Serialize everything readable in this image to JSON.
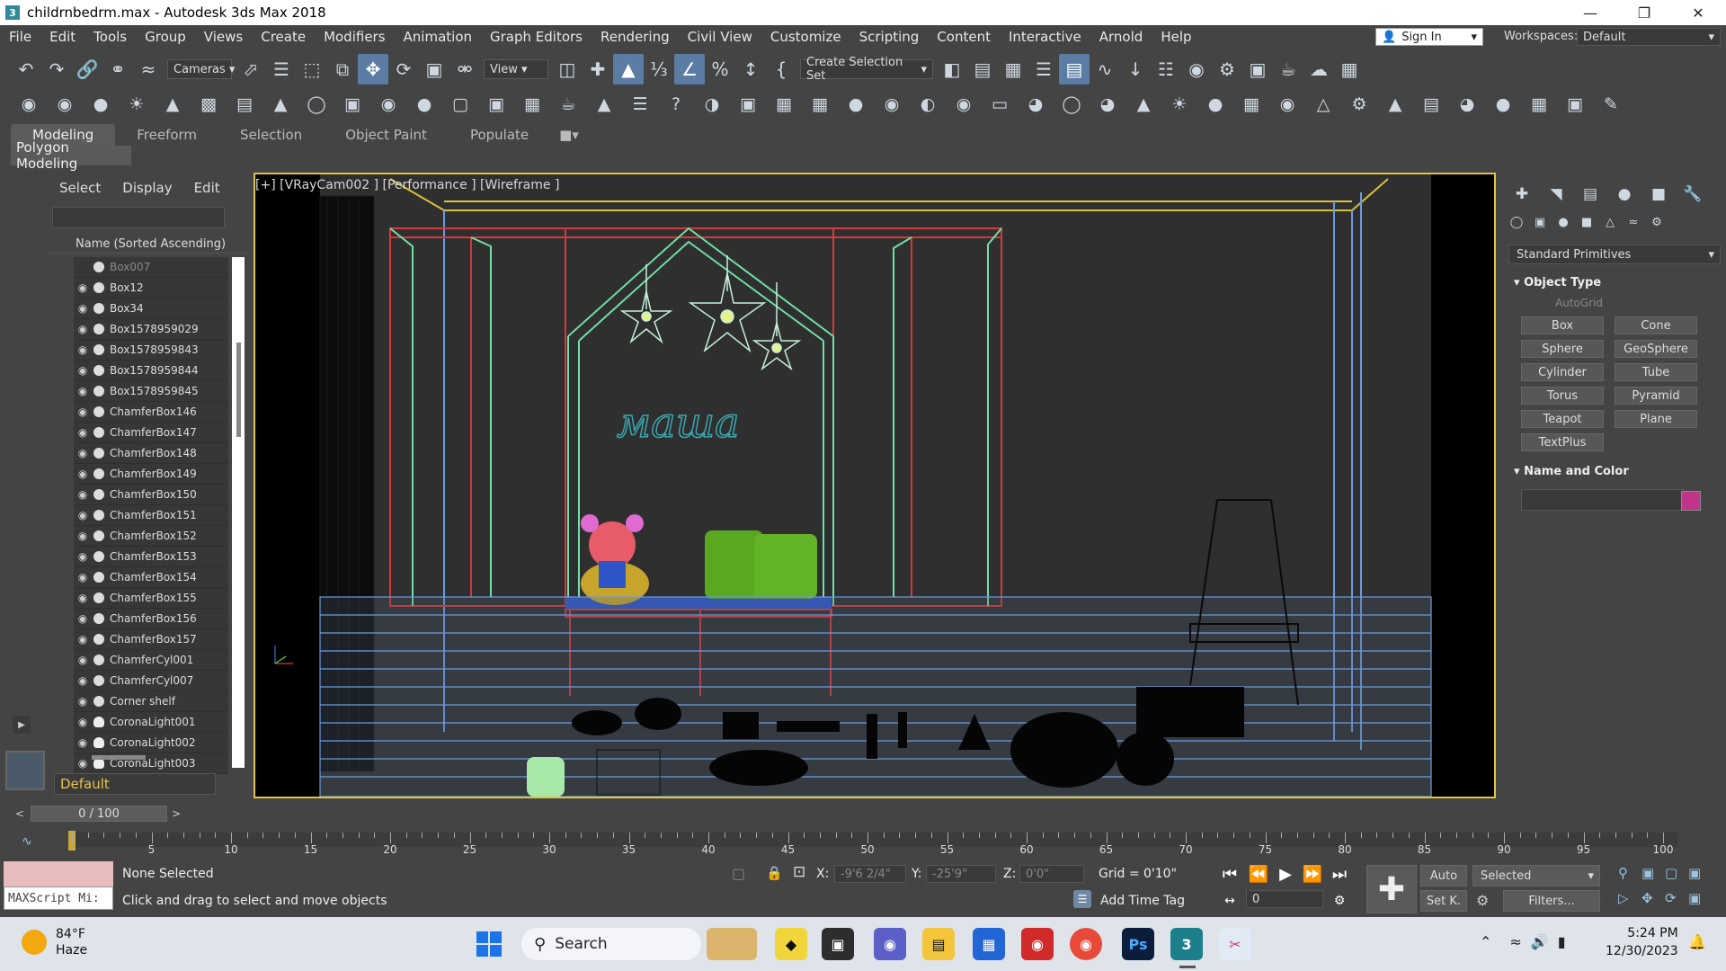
{
  "window": {
    "title": "childrnbedrm.max - Autodesk 3ds Max 2018",
    "app_icon_glyph": "3",
    "controls": [
      "minimize-icon",
      "maximize-icon",
      "close-icon"
    ]
  },
  "menu": {
    "items": [
      "File",
      "Edit",
      "Tools",
      "Group",
      "Views",
      "Create",
      "Modifiers",
      "Animation",
      "Graph Editors",
      "Rendering",
      "Civil View",
      "Customize",
      "Scripting",
      "Content",
      "Interactive",
      "Arnold",
      "Help"
    ],
    "sign_in": "Sign In",
    "workspaces_label": "Workspaces:",
    "workspace_value": "Default"
  },
  "toolbar1": {
    "cameras_dropdown": "Cameras",
    "view_dropdown": "View",
    "selection_set_dropdown": "Create Selection Set"
  },
  "ribbon": {
    "tabs": [
      "Modeling",
      "Freeform",
      "Selection",
      "Object Paint",
      "Populate"
    ],
    "selected_tab": "Modeling",
    "panel_label": "Polygon Modeling"
  },
  "explorer": {
    "menu": [
      "Select",
      "Display",
      "Edit"
    ],
    "column_header": "Name (Sorted Ascending)",
    "rows": [
      {
        "name": "Box007",
        "type": "geometry",
        "visible": false
      },
      {
        "name": "Box12",
        "type": "geometry",
        "visible": true
      },
      {
        "name": "Box34",
        "type": "geometry",
        "visible": true
      },
      {
        "name": "Box1578959029",
        "type": "geometry",
        "visible": true
      },
      {
        "name": "Box1578959843",
        "type": "geometry",
        "visible": true
      },
      {
        "name": "Box1578959844",
        "type": "geometry",
        "visible": true
      },
      {
        "name": "Box1578959845",
        "type": "geometry",
        "visible": true
      },
      {
        "name": "ChamferBox146",
        "type": "geometry",
        "visible": true
      },
      {
        "name": "ChamferBox147",
        "type": "geometry",
        "visible": true
      },
      {
        "name": "ChamferBox148",
        "type": "geometry",
        "visible": true
      },
      {
        "name": "ChamferBox149",
        "type": "geometry",
        "visible": true
      },
      {
        "name": "ChamferBox150",
        "type": "geometry",
        "visible": true
      },
      {
        "name": "ChamferBox151",
        "type": "geometry",
        "visible": true
      },
      {
        "name": "ChamferBox152",
        "type": "geometry",
        "visible": true
      },
      {
        "name": "ChamferBox153",
        "type": "geometry",
        "visible": true
      },
      {
        "name": "ChamferBox154",
        "type": "geometry",
        "visible": true
      },
      {
        "name": "ChamferBox155",
        "type": "geometry",
        "visible": true
      },
      {
        "name": "ChamferBox156",
        "type": "geometry",
        "visible": true
      },
      {
        "name": "ChamferBox157",
        "type": "geometry",
        "visible": true
      },
      {
        "name": "ChamferCyl001",
        "type": "geometry",
        "visible": true
      },
      {
        "name": "ChamferCyl007",
        "type": "geometry",
        "visible": true
      },
      {
        "name": "Corner shelf",
        "type": "geometry",
        "visible": true
      },
      {
        "name": "CoronaLight001",
        "type": "light",
        "visible": true
      },
      {
        "name": "CoronaLight002",
        "type": "light",
        "visible": true
      },
      {
        "name": "CoronaLight003",
        "type": "light",
        "visible": true
      }
    ],
    "layer": "Default"
  },
  "viewport": {
    "label": "[+] [VRayCam002 ] [Performance ] [Wireframe ]",
    "scene_text": "маша",
    "border_color": "#e2c53a"
  },
  "command_panel": {
    "category_dropdown": "Standard Primitives",
    "object_type_header": "Object Type",
    "autogrid": "AutoGrid",
    "buttons": [
      "Box",
      "Cone",
      "Sphere",
      "GeoSphere",
      "Cylinder",
      "Tube",
      "Torus",
      "Pyramid",
      "Teapot",
      "Plane",
      "TextPlus"
    ],
    "name_color_header": "Name and Color",
    "color": "#c2348a"
  },
  "timeline": {
    "frame": "0 / 100",
    "prev": "<",
    "next": ">",
    "ticks": [
      5,
      10,
      15,
      20,
      25,
      30,
      35,
      40,
      45,
      50,
      55,
      60,
      65,
      70,
      75,
      80,
      85,
      90,
      95,
      100
    ]
  },
  "status": {
    "maxscript": "MAXScript Mi:",
    "selection": "None Selected",
    "prompt": "Click and drag to select and move objects",
    "x_label": "X:",
    "x_value": "-9'6 2/4\"",
    "y_label": "Y:",
    "y_value": "-25'9\"",
    "z_label": "Z:",
    "z_value": "0'0\"",
    "grid": "Grid = 0'10\"",
    "add_time_tag": "Add Time Tag",
    "auto": "Auto",
    "selected_dropdown": "Selected",
    "setk": "Set K.",
    "filters": "Filters...",
    "frame_spinner": "0"
  },
  "taskbar": {
    "temperature": "84°F",
    "condition": "Haze",
    "search": "Search",
    "time": "5:24 PM",
    "date": "12/30/2023",
    "ps_label": "Ps",
    "max_label": "3"
  }
}
